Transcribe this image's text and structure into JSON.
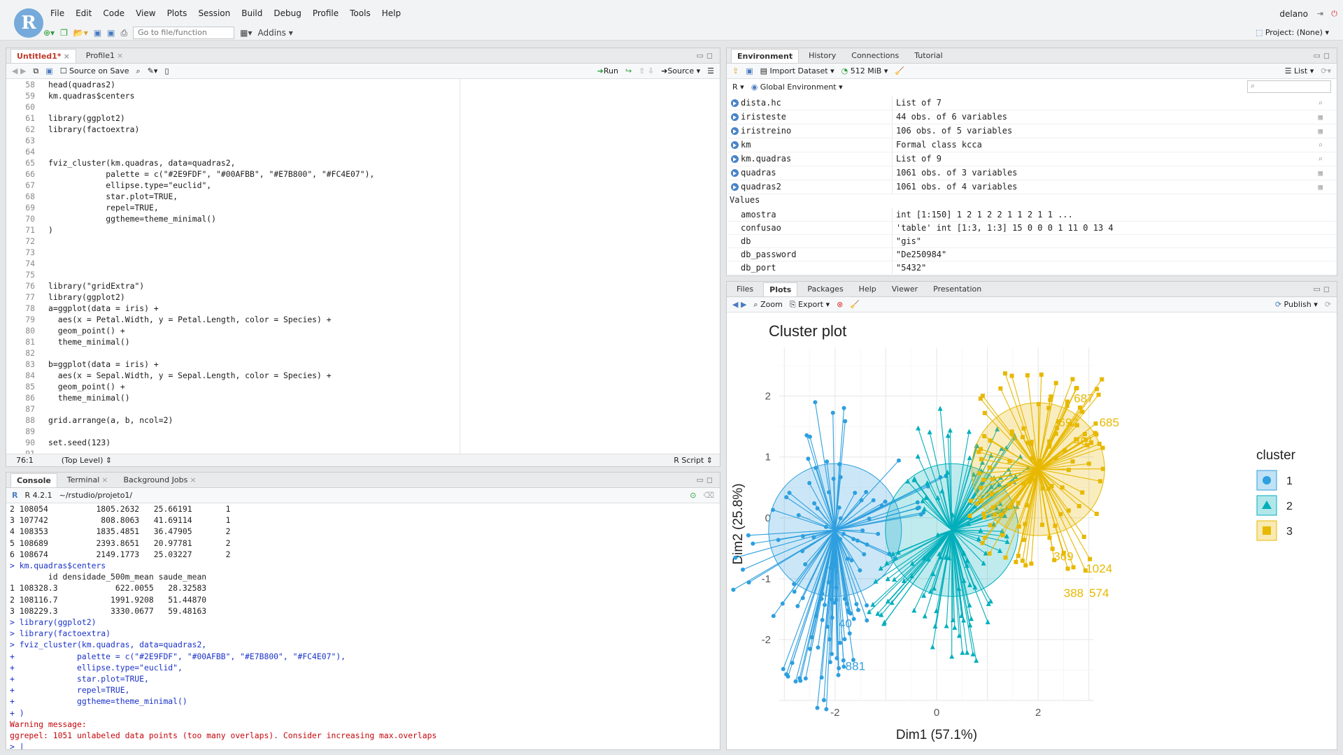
{
  "app": {
    "logo": "R",
    "menu": [
      "File",
      "Edit",
      "Code",
      "View",
      "Plots",
      "Session",
      "Build",
      "Debug",
      "Profile",
      "Tools",
      "Help"
    ],
    "user": "delano",
    "project": "Project: (None)",
    "goto_placeholder": "Go to file/function",
    "addins": "Addins"
  },
  "editor": {
    "tabs": [
      "Untitled1*",
      "Profile1"
    ],
    "source_on_save": "Source on Save",
    "run": "Run",
    "source": "Source",
    "line_numbers": [
      "58",
      "59",
      "60",
      "61",
      "62",
      "63",
      "64",
      "65",
      "66",
      "67",
      "68",
      "69",
      "70",
      "71",
      "72",
      "73",
      "74",
      "75",
      "76",
      "77",
      "78",
      "79",
      "80",
      "81",
      "82",
      "83",
      "84",
      "85",
      "86",
      "87",
      "88",
      "89",
      "90",
      "91"
    ],
    "lines": [
      "head(quadras2)",
      "km.quadras$centers",
      "",
      "library(ggplot2)",
      "library(factoextra)",
      "",
      "",
      "fviz_cluster(km.quadras, data=quadras2,",
      "            palette = c(\"#2E9FDF\", \"#00AFBB\", \"#E7B800\", \"#FC4E07\"),",
      "            ellipse.type=\"euclid\",",
      "            star.plot=TRUE,",
      "            repel=TRUE,",
      "            ggtheme=theme_minimal()",
      ")",
      "",
      "",
      "",
      "",
      "library(\"gridExtra\")",
      "library(ggplot2)",
      "a=ggplot(data = iris) +",
      "  aes(x = Petal.Width, y = Petal.Length, color = Species) +",
      "  geom_point() +",
      "  theme_minimal()",
      "",
      "b=ggplot(data = iris) +",
      "  aes(x = Sepal.Width, y = Sepal.Length, color = Species) +",
      "  geom_point() +",
      "  theme_minimal()",
      "",
      "grid.arrange(a, b, ncol=2)",
      "",
      "set.seed(123)",
      ""
    ],
    "cursor": "76:1",
    "scope": "(Top Level)",
    "filetype": "R Script"
  },
  "console": {
    "tabs": [
      "Console",
      "Terminal",
      "Background Jobs"
    ],
    "version": "R 4.2.1",
    "path": "~/rstudio/projeto1/",
    "lines": [
      {
        "t": "out",
        "s": "2 108054          1805.2632   25.66191       1"
      },
      {
        "t": "out",
        "s": "3 107742           808.8063   41.69114       1"
      },
      {
        "t": "out",
        "s": "4 108353          1835.4851   36.47905       2"
      },
      {
        "t": "out",
        "s": "5 108689          2393.8651   20.97781       2"
      },
      {
        "t": "out",
        "s": "6 108674          2149.1773   25.03227       2"
      },
      {
        "t": "in",
        "s": "> km.quadras$centers"
      },
      {
        "t": "out",
        "s": "        id densidade_500m_mean saude_mean"
      },
      {
        "t": "out",
        "s": "1 108328.3            622.0055   28.32583"
      },
      {
        "t": "out",
        "s": "2 108116.7           1991.9208   51.44870"
      },
      {
        "t": "out",
        "s": "3 108229.3           3330.0677   59.48163"
      },
      {
        "t": "in",
        "s": "> library(ggplot2)"
      },
      {
        "t": "in",
        "s": "> library(factoextra)"
      },
      {
        "t": "in",
        "s": "> fviz_cluster(km.quadras, data=quadras2,"
      },
      {
        "t": "in",
        "s": "+             palette = c(\"#2E9FDF\", \"#00AFBB\", \"#E7B800\", \"#FC4E07\"),"
      },
      {
        "t": "in",
        "s": "+             ellipse.type=\"euclid\","
      },
      {
        "t": "in",
        "s": "+             star.plot=TRUE,"
      },
      {
        "t": "in",
        "s": "+             repel=TRUE,"
      },
      {
        "t": "in",
        "s": "+             ggtheme=theme_minimal()"
      },
      {
        "t": "in",
        "s": "+ )"
      },
      {
        "t": "warn",
        "s": "Warning message:"
      },
      {
        "t": "warn",
        "s": "ggrepel: 1051 unlabeled data points (too many overlaps). Consider increasing max.overlaps"
      },
      {
        "t": "in",
        "s": "> |"
      }
    ]
  },
  "environment": {
    "tabs": [
      "Environment",
      "History",
      "Connections",
      "Tutorial"
    ],
    "import": "Import Dataset",
    "memory": "512 MiB",
    "view": "List",
    "lang": "R",
    "scope": "Global Environment",
    "data": [
      [
        "dista.hc",
        "List of  7"
      ],
      [
        "iristeste",
        "44 obs. of 6 variables"
      ],
      [
        "iristreino",
        "106 obs. of 5 variables"
      ],
      [
        "km",
        "Formal class  kcca"
      ],
      [
        "km.quadras",
        "List of  9"
      ],
      [
        "quadras",
        "1061 obs. of 3 variables"
      ],
      [
        "quadras2",
        "1061 obs. of 4 variables"
      ]
    ],
    "values_header": "Values",
    "values": [
      [
        "amostra",
        "int [1:150] 1 2 1 2 2 1 1 2 1 1 ..."
      ],
      [
        "confusao",
        "'table' int [1:3, 1:3] 15 0 0 0 1 11 0 13 4"
      ],
      [
        "db",
        "\"gis\""
      ],
      [
        "db_password",
        "\"De250984\""
      ],
      [
        "db_port",
        "\"5432\""
      ]
    ]
  },
  "files": {
    "tabs": [
      "Files",
      "Plots",
      "Packages",
      "Help",
      "Viewer",
      "Presentation"
    ],
    "zoom": "Zoom",
    "export": "Export",
    "publish": "Publish"
  },
  "chart_data": {
    "type": "scatter",
    "title": "Cluster plot",
    "xlabel": "Dim1 (57.1%)",
    "ylabel": "Dim2 (25.8%)",
    "xlim": [
      -3.1,
      3.1
    ],
    "ylim": [
      -3.0,
      2.8
    ],
    "xticks": [
      -2,
      0,
      2
    ],
    "yticks": [
      -2,
      -1,
      0,
      1,
      2
    ],
    "legend_title": "cluster",
    "legend_position": "right",
    "series": [
      {
        "name": "1",
        "color": "#2E9FDF",
        "shape": "circle",
        "center": [
          -2.0,
          -0.2
        ],
        "labels": [
          {
            "text": "40",
            "x": -1.8,
            "y": -1.8
          },
          {
            "text": "881",
            "x": -1.6,
            "y": -2.5
          }
        ]
      },
      {
        "name": "2",
        "color": "#00AFBB",
        "shape": "triangle",
        "center": [
          0.3,
          -0.2
        ],
        "labels": []
      },
      {
        "name": "3",
        "color": "#E7B800",
        "shape": "square",
        "center": [
          2.0,
          0.8
        ],
        "labels": [
          {
            "text": "687",
            "x": 2.9,
            "y": 1.9
          },
          {
            "text": "692",
            "x": 2.6,
            "y": 1.5
          },
          {
            "text": "685",
            "x": 3.4,
            "y": 1.5
          },
          {
            "text": "401",
            "x": 2.9,
            "y": 1.2
          },
          {
            "text": "369",
            "x": 2.5,
            "y": -0.7
          },
          {
            "text": "1024",
            "x": 3.2,
            "y": -0.9
          },
          {
            "text": "388",
            "x": 2.7,
            "y": -1.3
          },
          {
            "text": "574",
            "x": 3.2,
            "y": -1.3
          }
        ]
      }
    ]
  }
}
